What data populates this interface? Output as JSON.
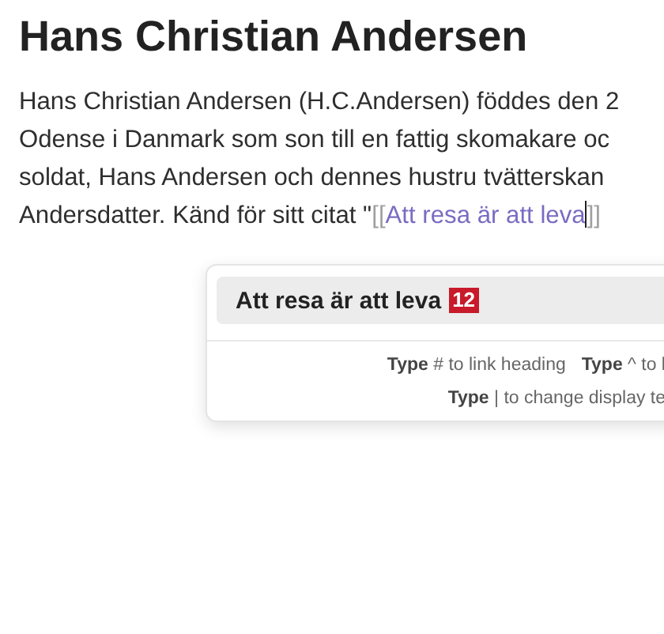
{
  "heading": "Hans Christian Andersen",
  "paragraph": {
    "lines": [
      "Hans Christian Andersen (H.C.Andersen) föddes den 2",
      "Odense i Danmark som son till en fattig skomakare oc",
      "soldat, Hans Andersen och dennes hustru tvätterskan",
      "Andersdatter. Känd för sitt citat \""
    ],
    "link_open": "[[",
    "link_text": "Att resa är att leva",
    "link_close": "]]"
  },
  "suggest": {
    "title": "Att resa är att leva",
    "badge": "12",
    "hints": [
      [
        "**Type** # to link heading",
        "**Type** ^ to l"
      ],
      [
        "**Type** | to change display te"
      ]
    ]
  }
}
